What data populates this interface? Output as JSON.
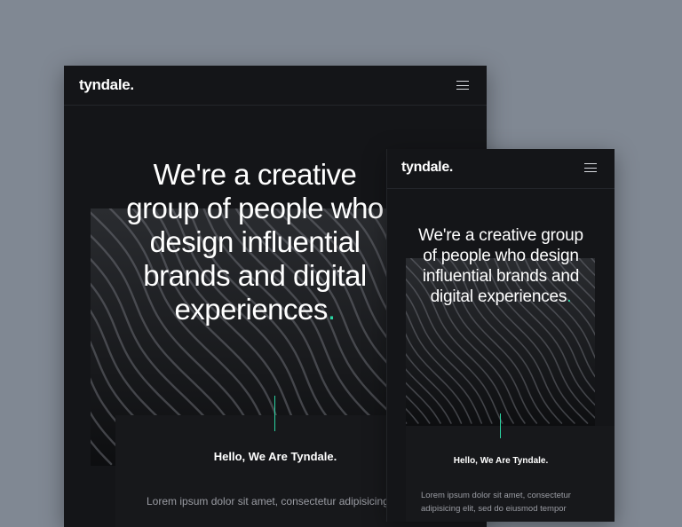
{
  "tablet": {
    "logo": "tyndale.",
    "hero_text": "We're a creative group of people who design influential brands and digital experiences",
    "hero_dot": ".",
    "hello": "Hello, We Are Tyndale.",
    "lorem": "Lorem ipsum dolor sit amet, consectetur adipisicing"
  },
  "phone": {
    "logo": "tyndale.",
    "hero_text": "We're a creative group of people who design influential brands and digital experiences",
    "hero_dot": ".",
    "hello": "Hello, We Are Tyndale.",
    "lorem": "Lorem ipsum dolor sit amet, consectetur adipisicing elit, sed do eiusmod tempor"
  },
  "icons": {
    "menu": "hamburger-menu-icon"
  },
  "colors": {
    "background": "#808893",
    "frame": "#141518",
    "accent": "#2bd4a2",
    "text": "#ffffff",
    "muted_text": "#9a9ca3"
  }
}
